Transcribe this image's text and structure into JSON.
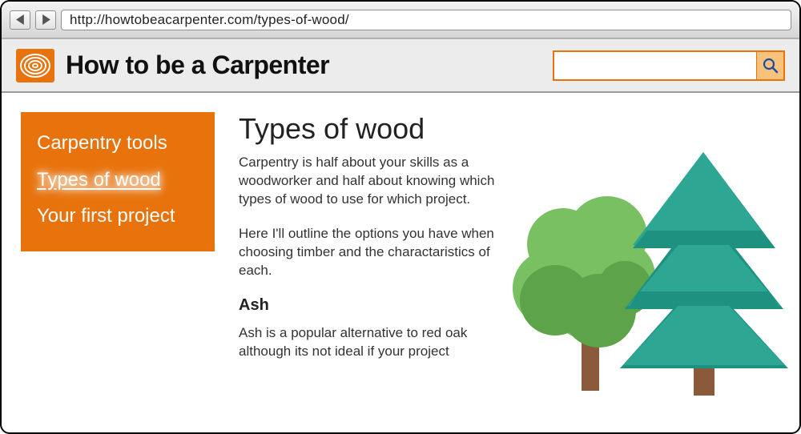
{
  "browser": {
    "url": "http://howtobeacarpenter.com/types-of-wood/"
  },
  "header": {
    "site_title": "How to be a Carpenter",
    "search_placeholder": ""
  },
  "sidebar": {
    "items": [
      {
        "label": "Carpentry tools",
        "active": false
      },
      {
        "label": "Types of wood",
        "active": true
      },
      {
        "label": "Your first project",
        "active": false
      }
    ]
  },
  "main": {
    "title": "Types of wood",
    "para1": "Carpentry is half about your skills as a woodworker and half about knowing which types of wood to use for which project.",
    "para2": "Here I'll outline the options you have when choosing timber and the charactaristics of each.",
    "subhead1": "Ash",
    "para3": "Ash is a popular alternative to red oak although its not ideal if your project"
  },
  "colors": {
    "accent": "#e8720c",
    "pine_dark": "#1e9181",
    "pine_mid": "#2da693",
    "tree_green": "#78c062",
    "tree_green_dark": "#5da349",
    "trunk": "#8a5a3a"
  }
}
